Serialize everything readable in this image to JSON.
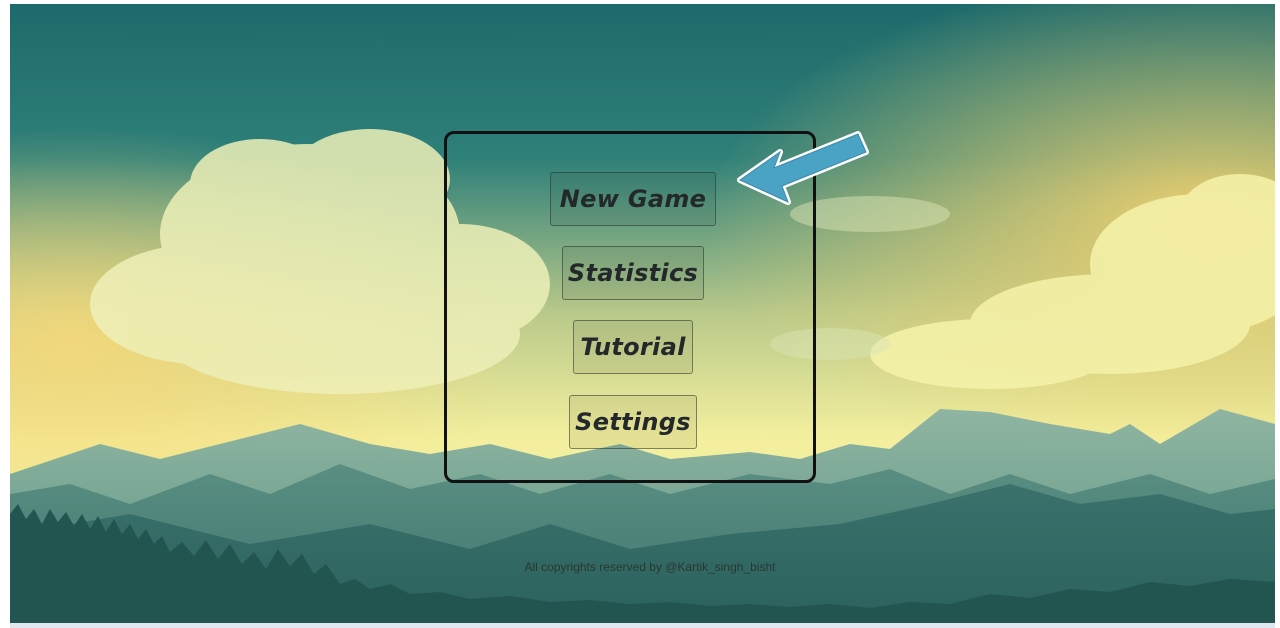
{
  "menu": {
    "items": [
      {
        "label": "New Game"
      },
      {
        "label": "Statistics"
      },
      {
        "label": "Tutorial"
      },
      {
        "label": "Settings"
      }
    ]
  },
  "footer": {
    "copyright": "All copyrights reserved by @Kartik_singh_bisht"
  },
  "colors": {
    "sky_top": "#1f6f6e",
    "sky_glow": "#f2f09a",
    "mountain_far": "#6f9c8c",
    "mountain_near": "#2f6b66",
    "arrow_fill": "#4aa3c4",
    "panel_border": "#111111"
  },
  "icons": {
    "pointer": "arrow-pointer-icon"
  }
}
